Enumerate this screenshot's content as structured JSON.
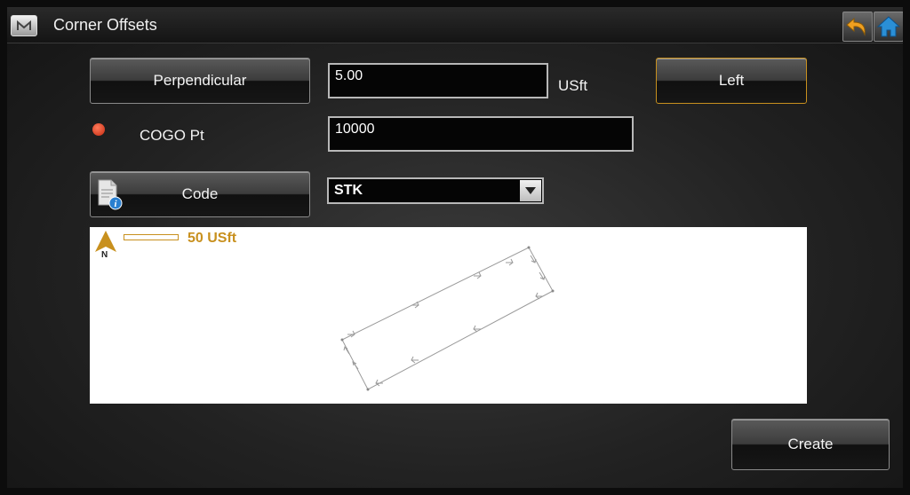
{
  "window": {
    "title": "Corner Offsets"
  },
  "form": {
    "method_button": "Perpendicular",
    "offset_value": "5.00",
    "offset_unit": "USft",
    "direction_button": "Left",
    "cogo_label": "COGO Pt",
    "cogo_value": "10000",
    "code_button": "Code",
    "code_value": "STK"
  },
  "map": {
    "scale_text": "50 USft",
    "north_letter": "N"
  },
  "actions": {
    "create": "Create"
  },
  "colors": {
    "accent": "#c8901e",
    "status_dot": "#d9351a",
    "home_icon": "#2a8fd6",
    "undo_icon": "#f0a020"
  },
  "icons": [
    "menu-icon",
    "undo-icon",
    "home-icon",
    "code-info-icon",
    "dropdown-arrow-icon",
    "north-arrow-icon"
  ]
}
